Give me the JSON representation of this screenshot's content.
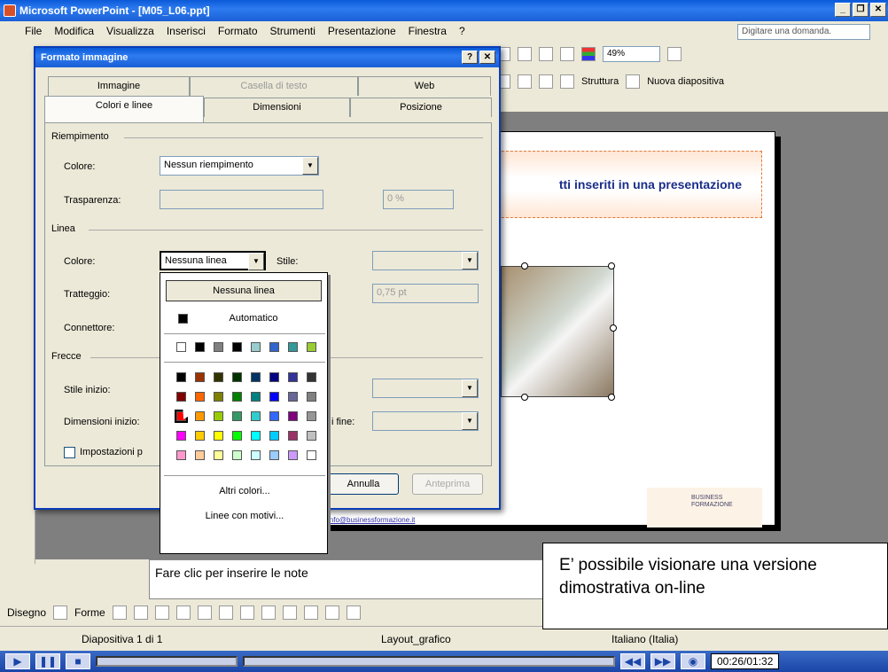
{
  "app": {
    "title": "Microsoft PowerPoint - [M05_L06.ppt]"
  },
  "menu": {
    "items": [
      "File",
      "Modifica",
      "Visualizza",
      "Inserisci",
      "Formato",
      "Strumenti",
      "Presentazione",
      "Finestra",
      "?"
    ],
    "ask_placeholder": "Digitare una domanda."
  },
  "toolbar": {
    "zoom": "49%",
    "struttura": "Struttura",
    "nuova_diapositiva": "Nuova diapositiva"
  },
  "slide": {
    "title": "tti inseriti in una presentazione",
    "link": "info@businessformazione.it"
  },
  "notes": {
    "placeholder": "Fare clic per inserire le note"
  },
  "drawbar": {
    "disegno": "Disegno",
    "forme": "Forme"
  },
  "status": {
    "slide_count": "Diapositiva 1 di 1",
    "layout": "Layout_grafico",
    "language": "Italiano (Italia)"
  },
  "player": {
    "time": "00:26/01:32"
  },
  "dialog": {
    "title": "Formato immagine",
    "tabs_back": [
      "Immagine",
      "Casella di testo",
      "Web"
    ],
    "tabs_front": [
      "Colori e linee",
      "Dimensioni",
      "Posizione"
    ],
    "riempimento": {
      "group": "Riempimento",
      "colore_label": "Colore:",
      "colore_value": "Nessun riempimento",
      "trasparenza_label": "Trasparenza:",
      "trasparenza_value": "0 %"
    },
    "linea": {
      "group": "Linea",
      "colore_label": "Colore:",
      "colore_value": "Nessuna linea",
      "stile_label": "Stile:",
      "tratteggio_label": "Tratteggio:",
      "spessore_value": "0,75 pt",
      "connettore_label": "Connettore:"
    },
    "frecce": {
      "group": "Frecce",
      "stile_inizio": "Stile inizio:",
      "dimensioni_inizio": "Dimensioni inizio:",
      "dimensioni_fine": "i fine:"
    },
    "impostazioni": "Impostazioni p",
    "annulla": "Annulla",
    "anteprima": "Anteprima"
  },
  "popup": {
    "nessuna_linea": "Nessuna linea",
    "automatico": "Automatico",
    "altri_colori": "Altri colori...",
    "linee_motivi": "Linee con motivi..."
  },
  "colors": {
    "recent": [
      "#ffffff",
      "#000000",
      "#808080",
      "#000000",
      "#99cccc",
      "#3366cc",
      "#339999",
      "#99cc33"
    ],
    "grid": [
      [
        "#000000",
        "#993300",
        "#333300",
        "#003300",
        "#003366",
        "#000080",
        "#333399",
        "#333333"
      ],
      [
        "#800000",
        "#ff6600",
        "#808000",
        "#008000",
        "#008080",
        "#0000ff",
        "#666699",
        "#808080"
      ],
      [
        "#ff0000",
        "#ff9900",
        "#99cc00",
        "#339966",
        "#33cccc",
        "#3366ff",
        "#800080",
        "#969696"
      ],
      [
        "#ff00ff",
        "#ffcc00",
        "#ffff00",
        "#00ff00",
        "#00ffff",
        "#00ccff",
        "#993366",
        "#c0c0c0"
      ],
      [
        "#ff99cc",
        "#ffcc99",
        "#ffff99",
        "#ccffcc",
        "#ccffff",
        "#99ccff",
        "#cc99ff",
        "#ffffff"
      ]
    ]
  },
  "callout": {
    "text": "E’ possibile visionare una versione dimostrativa on-line"
  }
}
